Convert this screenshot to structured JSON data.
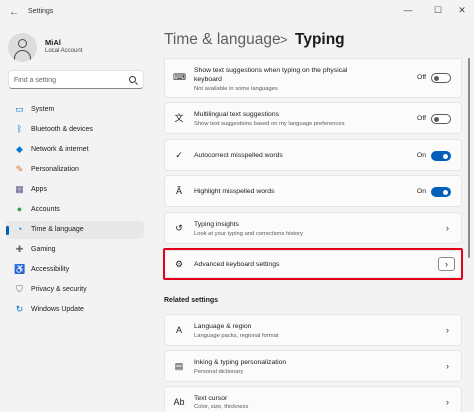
{
  "window": {
    "back_glyph": "←",
    "title": "Settings",
    "minimize_glyph": "—",
    "maximize_glyph": "☐",
    "close_glyph": "✕"
  },
  "user": {
    "name": "MiAl",
    "account": "Local Account"
  },
  "search": {
    "placeholder": "Find a setting"
  },
  "nav": [
    {
      "label": "System",
      "icon": "monitor-icon",
      "color": "#0078d4"
    },
    {
      "label": "Bluetooth & devices",
      "icon": "bluetooth-icon",
      "color": "#0078d4"
    },
    {
      "label": "Network & internet",
      "icon": "wifi-icon",
      "color": "#0078d4"
    },
    {
      "label": "Personalization",
      "icon": "brush-icon",
      "color": "#e06d1a"
    },
    {
      "label": "Apps",
      "icon": "apps-icon",
      "color": "#5a5a8a"
    },
    {
      "label": "Accounts",
      "icon": "person-icon",
      "color": "#2aa45e"
    },
    {
      "label": "Time & language",
      "icon": "globe-clock-icon",
      "color": "#0078d4",
      "selected": true
    },
    {
      "label": "Gaming",
      "icon": "gamepad-icon",
      "color": "#6b6b6b"
    },
    {
      "label": "Accessibility",
      "icon": "accessibility-icon",
      "color": "#1e88e5"
    },
    {
      "label": "Privacy & security",
      "icon": "shield-icon",
      "color": "#6b6b6b"
    },
    {
      "label": "Windows Update",
      "icon": "update-icon",
      "color": "#0078d4"
    }
  ],
  "breadcrumb": {
    "parent": "Time & language",
    "separator": ">",
    "current": "Typing"
  },
  "settings": [
    {
      "title": "Show text suggestions when typing on the physical",
      "title2": "keyboard",
      "subtitle": "Not available in some languages",
      "state": "Off",
      "icon": "keyboard-icon"
    },
    {
      "title": "Multilingual text suggestions",
      "subtitle": "Show text suggestions based on my language preferences",
      "state": "Off",
      "icon": "multilingual-icon"
    },
    {
      "title": "Autocorrect misspelled words",
      "state": "On",
      "icon": "autocorrect-icon"
    },
    {
      "title": "Highlight misspelled words",
      "state": "On",
      "icon": "highlight-icon"
    },
    {
      "title": "Typing insights",
      "subtitle": "Look at your typing and corrections history",
      "icon": "insights-icon"
    },
    {
      "title": "Advanced keyboard settings",
      "icon": "gear-icon"
    }
  ],
  "related": {
    "heading": "Related settings",
    "items": [
      {
        "title": "Language & region",
        "subtitle": "Language packs, regional format",
        "icon": "language-icon"
      },
      {
        "title": "Inking & typing personalization",
        "subtitle": "Personal dictionary",
        "icon": "dictionary-icon"
      },
      {
        "title": "Text cursor",
        "subtitle": "Color, size, thickness",
        "icon": "text-cursor-icon"
      }
    ]
  },
  "chevron": "›",
  "colors": {
    "accent": "#005fb8",
    "highlight_border": "#e2001a"
  }
}
